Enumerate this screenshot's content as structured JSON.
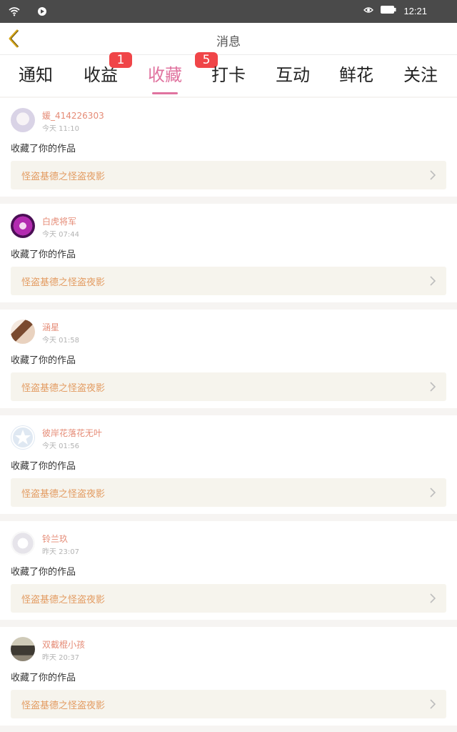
{
  "status_bar": {
    "time": "12:21"
  },
  "header": {
    "title": "消息",
    "back_icon": "chevron-left-icon"
  },
  "tabs": [
    {
      "label": "通知"
    },
    {
      "label": "收益",
      "badge": "1"
    },
    {
      "label": "收藏",
      "badge": "5",
      "active": true
    },
    {
      "label": "打卡"
    },
    {
      "label": "互动"
    },
    {
      "label": "鲜花"
    },
    {
      "label": "关注"
    }
  ],
  "colors": {
    "accent": "#e0739f",
    "badge": "#f04548",
    "username": "#e58b76",
    "work_title": "#e39b61"
  },
  "messages": [
    {
      "username": "媛_414226303",
      "time": "今天 11:10",
      "action": "收藏了你的作品",
      "work_title": "怪盗基德之怪盗夜影"
    },
    {
      "username": "白虎将军",
      "time": "今天 07:44",
      "action": "收藏了你的作品",
      "work_title": "怪盗基德之怪盗夜影"
    },
    {
      "username": "涵星",
      "time": "今天 01:58",
      "action": "收藏了你的作品",
      "work_title": "怪盗基德之怪盗夜影"
    },
    {
      "username": "彼岸花落花无叶",
      "time": "今天 01:56",
      "action": "收藏了你的作品",
      "work_title": "怪盗基德之怪盗夜影"
    },
    {
      "username": "铃兰玖",
      "time": "昨天 23:07",
      "action": "收藏了你的作品",
      "work_title": "怪盗基德之怪盗夜影"
    },
    {
      "username": "双截棍小孩",
      "time": "昨天 20:37",
      "action": "收藏了你的作品",
      "work_title": "怪盗基德之怪盗夜影"
    }
  ]
}
